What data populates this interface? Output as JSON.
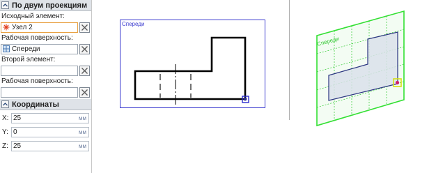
{
  "projections_section": {
    "title": "По двум проекциям",
    "source_element_label": "Исходный элемент:",
    "source_element_value": "Узел 2",
    "work_surface_label": "Рабочая поверхность:",
    "work_surface_value": "Спереди",
    "second_element_label": "Второй элемент:",
    "second_element_value": "",
    "second_work_surface_label": "Рабочая поверхность:",
    "second_work_surface_value": ""
  },
  "coordinates_section": {
    "title": "Координаты",
    "x_label": "X:",
    "x_value": "25",
    "x_unit": "мм",
    "y_label": "Y:",
    "y_value": "0",
    "y_unit": "мм",
    "z_label": "Z:",
    "z_value": "25",
    "z_unit": "мм"
  },
  "left_view": {
    "label": "Спереди"
  },
  "right_view": {
    "label": "Спереди"
  },
  "colors": {
    "view_frame": "#3a3acf",
    "green_plane": "#33e033",
    "profile_fill": "#d9e0ea",
    "profile_stroke": "#2a3580"
  }
}
